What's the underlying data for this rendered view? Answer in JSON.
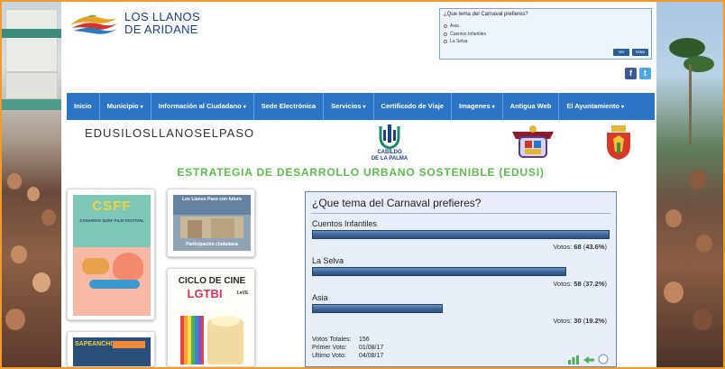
{
  "header": {
    "logo_line1": "LOS LLANOS",
    "logo_line2": "DE ARIDANE"
  },
  "mini_poll": {
    "question": "¿Que tema del Carnaval prefieres?",
    "options": [
      "Asia",
      "Cuentos Infantiles",
      "La Selva"
    ],
    "vote_button": "Ver",
    "results_button": "Votar"
  },
  "social": {
    "facebook": "f",
    "twitter": "t"
  },
  "nav": {
    "items": [
      {
        "label": "Inicio",
        "has_dropdown": false
      },
      {
        "label": "Municipio",
        "has_dropdown": true
      },
      {
        "label": "Información al Ciudadano",
        "has_dropdown": true
      },
      {
        "label": "Sede Electrónica",
        "has_dropdown": false
      },
      {
        "label": "Servicios",
        "has_dropdown": true
      },
      {
        "label": "Certificado de Viaje",
        "has_dropdown": false
      },
      {
        "label": "Imagenes",
        "has_dropdown": true
      },
      {
        "label": "Antigua Web",
        "has_dropdown": false
      },
      {
        "label": "El Ayuntamiento",
        "has_dropdown": true
      }
    ],
    "caret": "▾"
  },
  "banner": {
    "left_text": "EDUSILOSLLANOSELPASO",
    "cabildo_line1": "CABILDO",
    "cabildo_line2": "DE LA PALMA",
    "strategy": "ESTRATEGIA DE DESARROLLO URBANO SOSTENIBLE  (EDUSI)"
  },
  "posters": {
    "surf_title": "CSFF",
    "surf_sub": "CANARIAS SURF FILM FESTIVAL",
    "participation_caption": "Participación ciudadana",
    "participation_header": "Los Llanos Paso con futuro",
    "cine_line1": "CICLO DE CINE",
    "cine_line2": "LGTBI",
    "cine_love": "L♥VE",
    "bottom_left_title": "SAPEANCHO"
  },
  "poll": {
    "title": "¿Que tema del Carnaval prefieres?",
    "options": [
      {
        "label": "Cuentos Infantiles",
        "votes_prefix": "Votos:",
        "votes": "68",
        "percent": "43.6%",
        "fraction": 0.436
      },
      {
        "label": "La Selva",
        "votes_prefix": "Votos:",
        "votes": "58",
        "percent": "37.2%",
        "fraction": 0.372
      },
      {
        "label": "Asia",
        "votes_prefix": "Votos:",
        "votes": "30",
        "percent": "19.2%",
        "fraction": 0.192
      }
    ],
    "total_label": "Votos Totales:",
    "total_value": "156",
    "first_label": "Primer Voto:",
    "first_value": "01/08/17",
    "last_label": "Ultimo Voto:",
    "last_value": "04/08/17"
  },
  "colors": {
    "nav_bg": "#2b74c6",
    "strategy_green": "#5cbd4a",
    "page_border": "#f39a2c",
    "bar_blue": "#3c6699"
  }
}
